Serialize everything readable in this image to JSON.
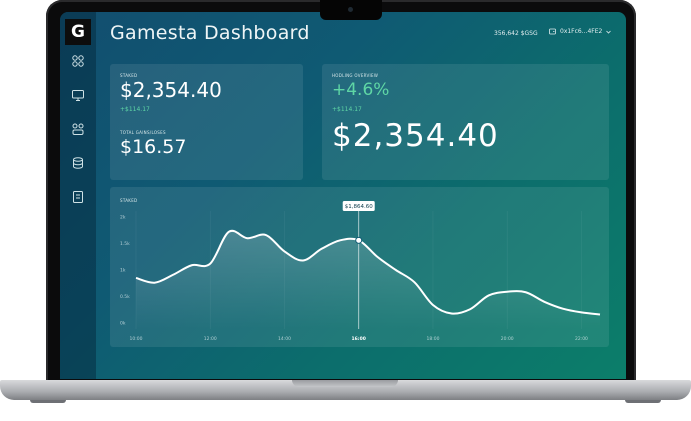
{
  "app": {
    "title": "Gamesta Dashboard",
    "logo_letter": "G"
  },
  "header": {
    "balance": "356,642 $GSG",
    "wallet": "0x1Fc6...4FE2"
  },
  "sidebar": {
    "items": [
      {
        "icon": "grid-icon"
      },
      {
        "icon": "monitor-icon"
      },
      {
        "icon": "gamepad-icon"
      },
      {
        "icon": "database-icon"
      },
      {
        "icon": "document-icon"
      }
    ]
  },
  "staked_card": {
    "label": "STAKED",
    "value": "$2,354.40",
    "change": "+$114.17",
    "gains_label": "TOTAL GAINS/LOSES",
    "gains_value": "$16.57"
  },
  "holding_card": {
    "label": "HODLING OVERVIEW",
    "percent": "+4.6%",
    "change": "+$114.17",
    "value": "$2,354.40"
  },
  "chart_card": {
    "label": "STAKED",
    "tooltip": "$1,864.60"
  },
  "colors": {
    "accent_green": "#5fd6a5",
    "screen_start": "#124e6f",
    "screen_end": "#0c7e6a"
  },
  "chart_data": {
    "type": "line",
    "title": "STAKED",
    "ytick_labels": [
      "2k",
      "1.5k",
      "1k",
      "0.5k",
      "0k"
    ],
    "ylim": [
      0,
      2000
    ],
    "xtick_labels": [
      "10:00",
      "12:00",
      "14:00",
      "16:00",
      "18:00",
      "20:00",
      "22:00"
    ],
    "xlim": [
      10,
      22.5
    ],
    "highlight": {
      "x": 16,
      "label": "$1,864.60"
    },
    "x": [
      10,
      10.5,
      11,
      11.5,
      12,
      12.5,
      13,
      13.5,
      14,
      14.5,
      15,
      15.5,
      16,
      16.5,
      17,
      17.5,
      18,
      18.5,
      19,
      19.5,
      20,
      20.5,
      21,
      21.5,
      22,
      22.5
    ],
    "y": [
      850,
      760,
      910,
      1090,
      1120,
      1720,
      1600,
      1660,
      1350,
      1180,
      1400,
      1560,
      1560,
      1250,
      1000,
      770,
      340,
      180,
      260,
      520,
      590,
      580,
      400,
      270,
      200,
      160
    ]
  }
}
